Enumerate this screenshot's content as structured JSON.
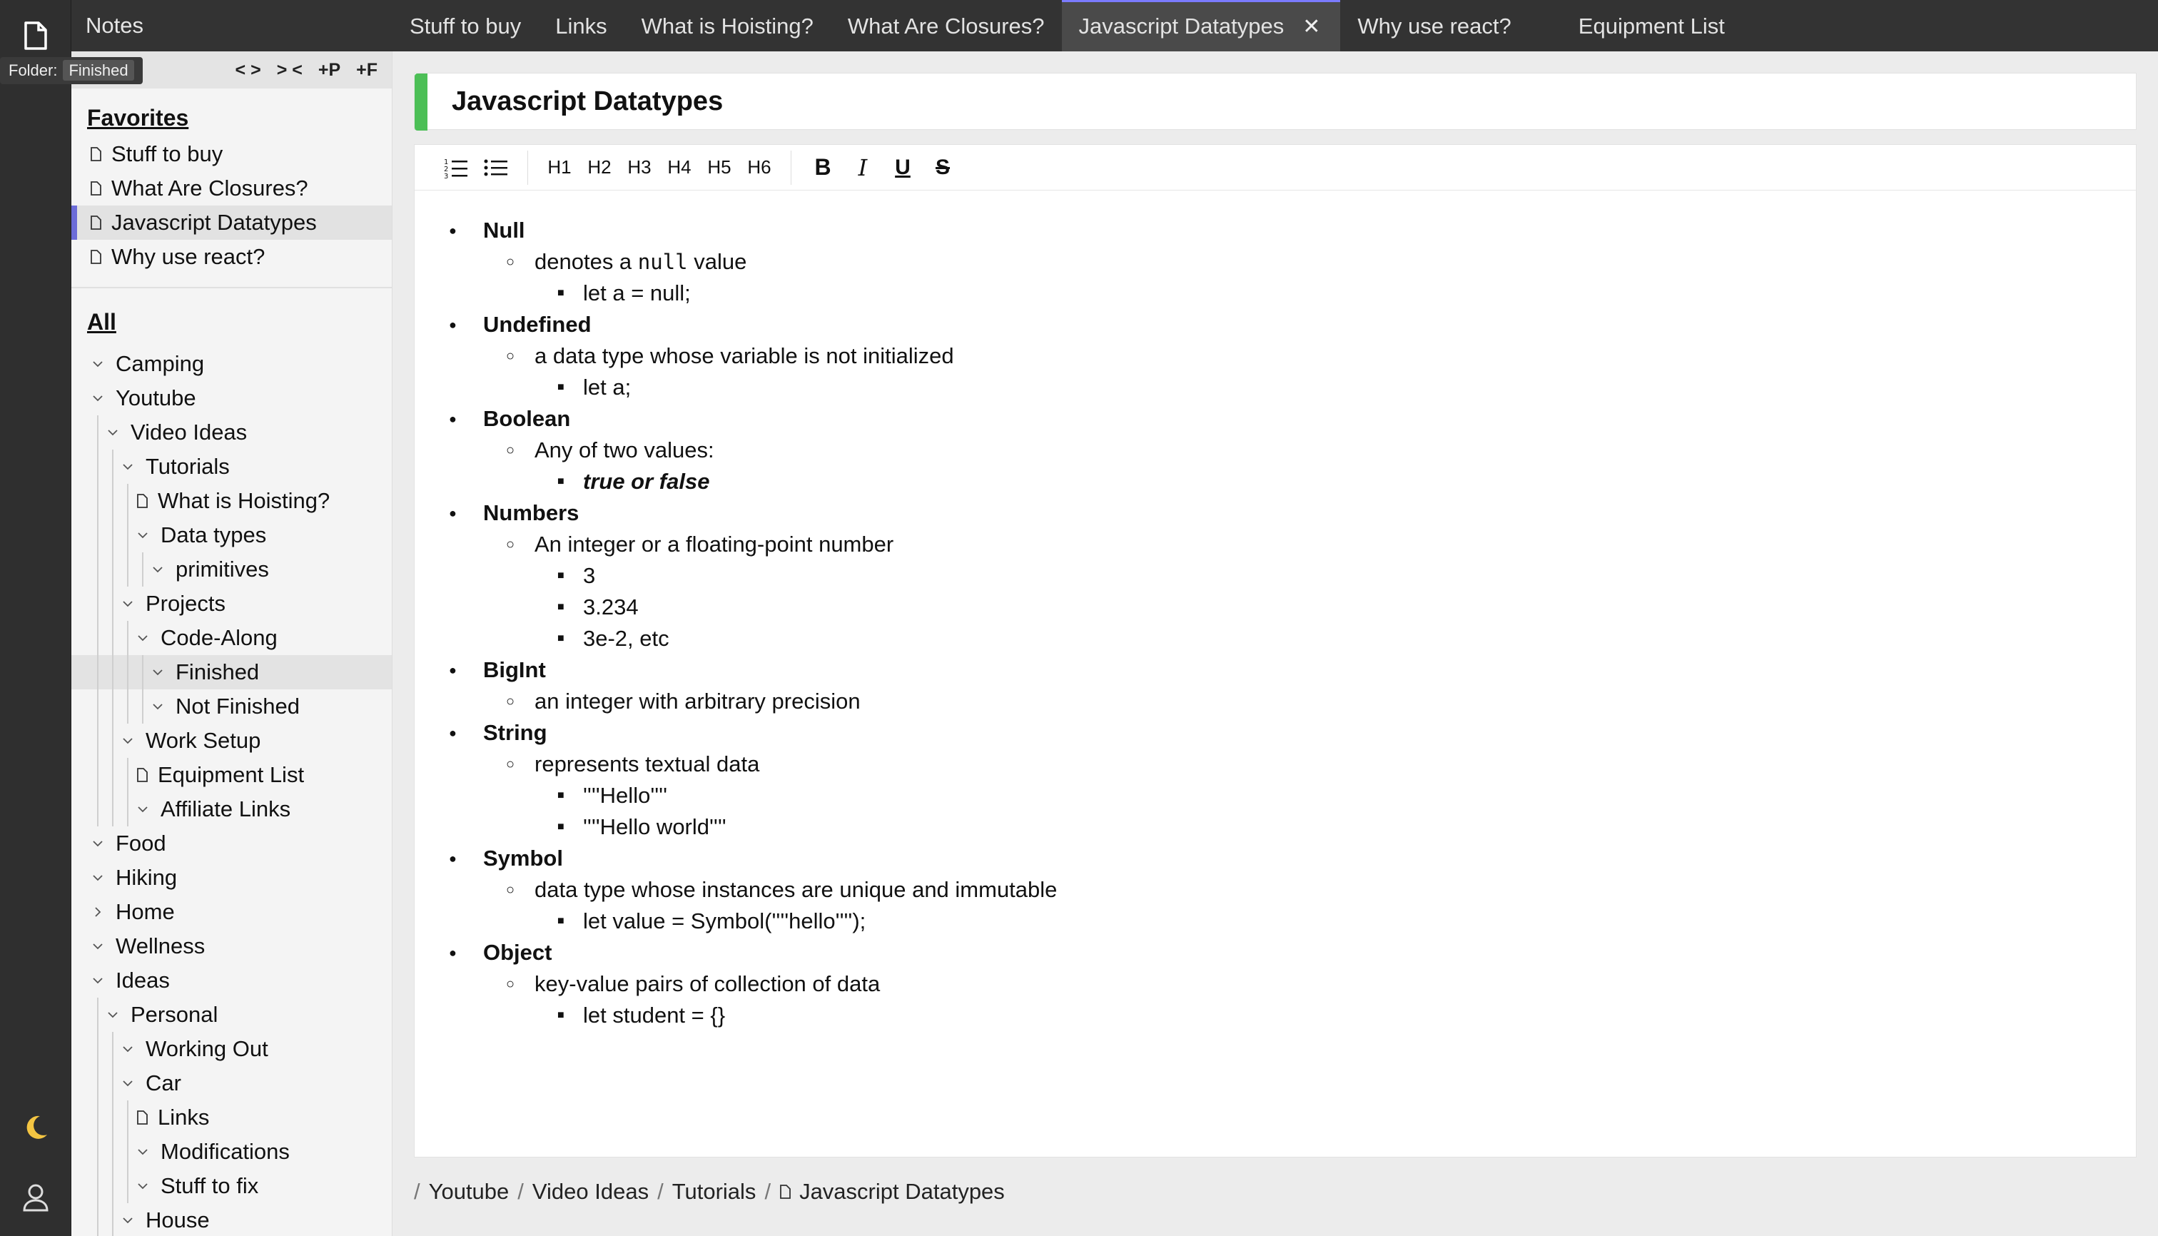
{
  "app": {
    "title": "Notes"
  },
  "tabs": [
    {
      "label": "Stuff to buy",
      "active": false
    },
    {
      "label": "Links",
      "active": false
    },
    {
      "label": "What is Hoisting?",
      "active": false
    },
    {
      "label": "What Are Closures?",
      "active": false
    },
    {
      "label": "Javascript Datatypes",
      "active": true
    },
    {
      "label": "Why use react?",
      "active": false
    },
    {
      "label": "Equipment List",
      "active": false
    }
  ],
  "sidebar": {
    "toolbar": [
      "< >",
      "> <",
      "+P",
      "+F"
    ],
    "tooltip": {
      "prefix": "Folder:",
      "value": "Finished"
    },
    "favorites_title": "Favorites",
    "favorites": [
      "Stuff to buy",
      "What Are Closures?",
      "Javascript Datatypes",
      "Why use react?"
    ],
    "all_title": "All",
    "tree": [
      {
        "label": "Camping",
        "depth": 0,
        "type": "folder"
      },
      {
        "label": "Youtube",
        "depth": 0,
        "type": "folder"
      },
      {
        "label": "Video Ideas",
        "depth": 1,
        "type": "folder"
      },
      {
        "label": "Tutorials",
        "depth": 2,
        "type": "folder"
      },
      {
        "label": "What is Hoisting?",
        "depth": 3,
        "type": "file"
      },
      {
        "label": "Data types",
        "depth": 3,
        "type": "folder"
      },
      {
        "label": "primitives",
        "depth": 4,
        "type": "folder"
      },
      {
        "label": "Projects",
        "depth": 2,
        "type": "folder"
      },
      {
        "label": "Code-Along",
        "depth": 3,
        "type": "folder"
      },
      {
        "label": "Finished",
        "depth": 4,
        "type": "folder",
        "highlight": true
      },
      {
        "label": "Not Finished",
        "depth": 4,
        "type": "folder"
      },
      {
        "label": "Work Setup",
        "depth": 2,
        "type": "folder"
      },
      {
        "label": "Equipment List",
        "depth": 3,
        "type": "file"
      },
      {
        "label": "Affiliate Links",
        "depth": 3,
        "type": "folder"
      },
      {
        "label": "Food",
        "depth": 0,
        "type": "folder"
      },
      {
        "label": "Hiking",
        "depth": 0,
        "type": "folder"
      },
      {
        "label": "Home",
        "depth": 0,
        "type": "folder",
        "collapsed": true
      },
      {
        "label": "Wellness",
        "depth": 0,
        "type": "folder"
      },
      {
        "label": "Ideas",
        "depth": 0,
        "type": "folder"
      },
      {
        "label": "Personal",
        "depth": 1,
        "type": "folder"
      },
      {
        "label": "Working Out",
        "depth": 2,
        "type": "folder"
      },
      {
        "label": "Car",
        "depth": 2,
        "type": "folder"
      },
      {
        "label": "Links",
        "depth": 3,
        "type": "file"
      },
      {
        "label": "Modifications",
        "depth": 3,
        "type": "folder"
      },
      {
        "label": "Stuff to fix",
        "depth": 3,
        "type": "folder"
      },
      {
        "label": "House",
        "depth": 2,
        "type": "folder"
      }
    ]
  },
  "note": {
    "title": "Javascript Datatypes",
    "toolbar": {
      "headings": [
        "H1",
        "H2",
        "H3",
        "H4",
        "H5",
        "H6"
      ],
      "bold": "B",
      "italic": "I",
      "underline": "U",
      "strike": "S"
    },
    "content": {
      "null_title": "Null",
      "null_desc_pre": "denotes a ",
      "null_desc_code": "null",
      "null_desc_post": " value",
      "null_ex": "let a = null;",
      "undef_title": "Undefined",
      "undef_desc": "a data type whose variable is not initialized",
      "undef_ex": "let a;",
      "bool_title": "Boolean",
      "bool_desc": "Any of two values:",
      "bool_ex": "true or false",
      "num_title": "Numbers",
      "num_desc": "An integer or a floating-point number",
      "num_ex1": "3",
      "num_ex2": "3.234",
      "num_ex3": "3e-2, etc",
      "bigint_title": "BigInt",
      "bigint_desc": "an integer with arbitrary precision",
      "str_title": "String",
      "str_desc": "represents textual data",
      "str_ex1": "''''Hello''''",
      "str_ex2": "''''Hello world''''",
      "sym_title": "Symbol",
      "sym_desc": "data type whose instances are unique and immutable",
      "sym_ex": "let value = Symbol(''''hello'''');",
      "obj_title": "Object",
      "obj_desc": "key-value pairs of collection of data",
      "obj_ex": "let student = {}"
    }
  },
  "breadcrumb": {
    "lead": "/",
    "parts": [
      "Youtube",
      "Video Ideas",
      "Tutorials"
    ],
    "current": "Javascript Datatypes"
  }
}
